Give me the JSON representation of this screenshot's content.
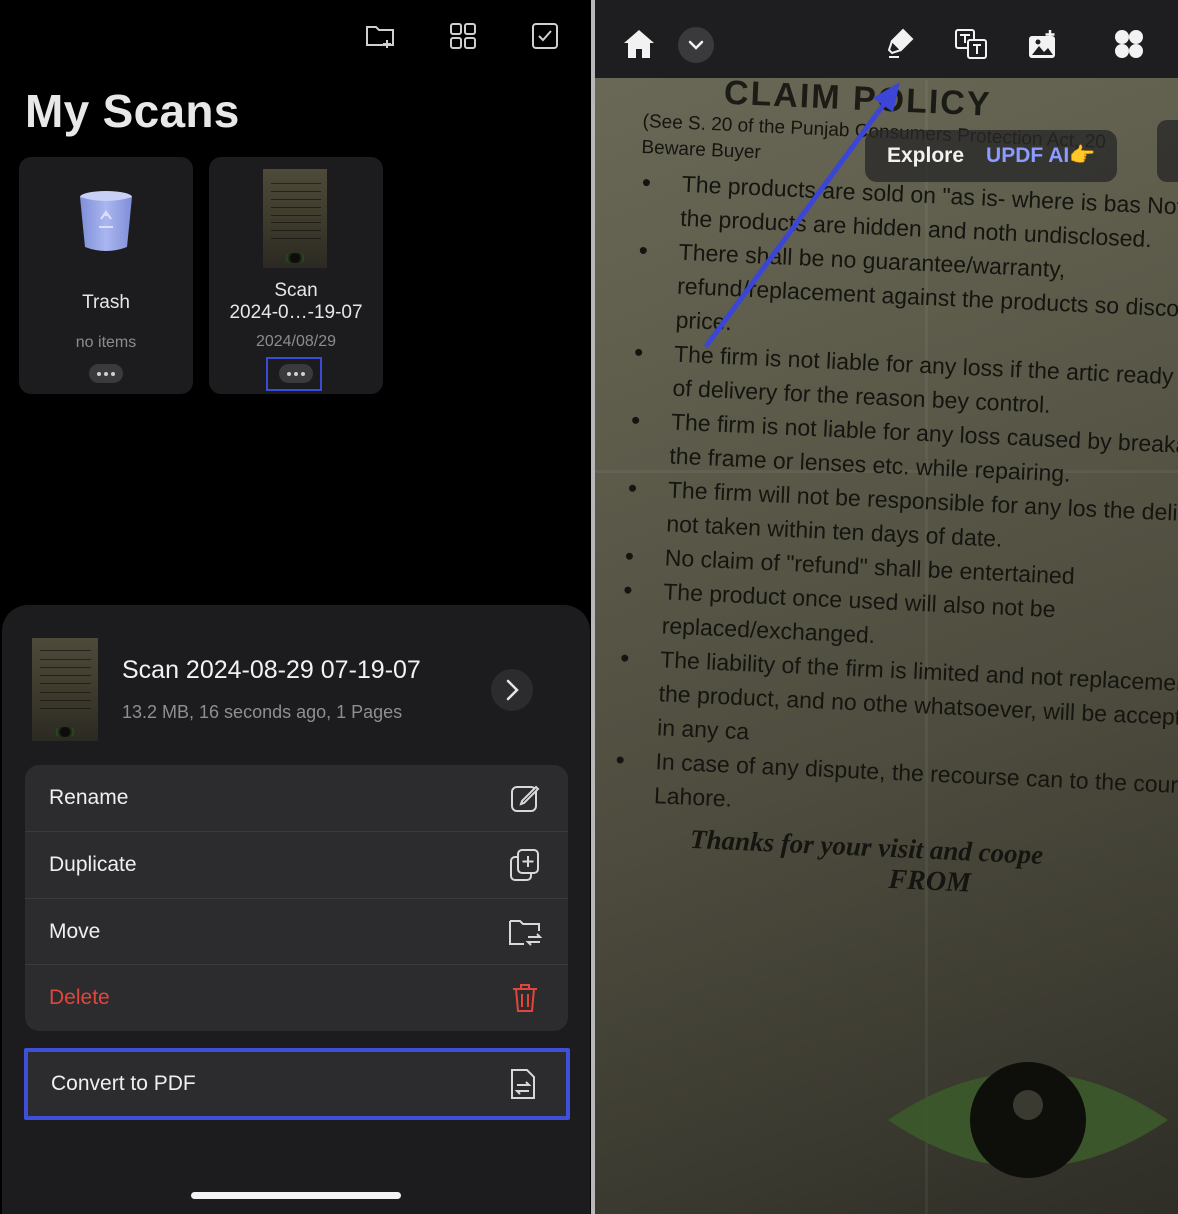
{
  "left_panel": {
    "title": "My Scans",
    "header_icons": [
      "new-folder-icon",
      "grid-view-icon",
      "select-checkbox-icon"
    ],
    "cards": [
      {
        "name": "Trash",
        "sub": "no items",
        "icon": "trash-icon"
      },
      {
        "name_line1": "Scan",
        "name_line2": "2024-0…-19-07",
        "sub": "2024/08/29",
        "icon": "scan-thumbnail"
      }
    ]
  },
  "sheet": {
    "title": "Scan 2024-08-29 07-19-07",
    "meta": "13.2 MB, 16 seconds ago, 1 Pages",
    "actions": [
      {
        "label": "Rename",
        "icon": "rename-icon"
      },
      {
        "label": "Duplicate",
        "icon": "duplicate-icon"
      },
      {
        "label": "Move",
        "icon": "move-folder-icon"
      },
      {
        "label": "Delete",
        "icon": "trash-icon",
        "color": "#e0463c"
      }
    ],
    "convert": {
      "label": "Convert to PDF",
      "icon": "convert-pdf-icon",
      "highlight_color": "#3f4fd8"
    }
  },
  "right_panel": {
    "toolbar_icons": [
      "home-icon",
      "chevron-down-icon",
      "highlighter-icon",
      "translate-icon",
      "image-edit-icon",
      "apps-icon"
    ],
    "explore_banner": {
      "text": "Explore",
      "ai_text": "UPDF AI👉"
    },
    "document": {
      "heading": "CLAIM POLICY",
      "ref": "(See S. 20 of the Punjab Consumers Protection Act, 20",
      "beware": "Beware Buyer",
      "bullets": [
        "The products are sold on \"as is- where is bas Nothing in the products are hidden and noth undisclosed.",
        "There shall be no guarantee/warranty, refund/replacement against the products so discounted price.",
        "The firm is not liable for any loss if the artic ready in time of delivery for the reason bey control.",
        "The firm is not liable for any loss caused by breakage of the frame or lenses etc. while repairing.",
        "The firm will not be responsible for any los the delivery is not taken within ten days of date.",
        "No claim of \"refund\" shall be entertained",
        "The product once used will also not be replaced/exchanged.",
        "The liability of the firm is limited and not replacement of the product, and no othe whatsoever, will be acceptable, in any ca",
        "In case of any dispute, the recourse can to the courts at Lahore."
      ],
      "thanks": "Thanks for your visit and coope",
      "from": "FROM"
    },
    "annotation_color": "#3b46d6"
  }
}
